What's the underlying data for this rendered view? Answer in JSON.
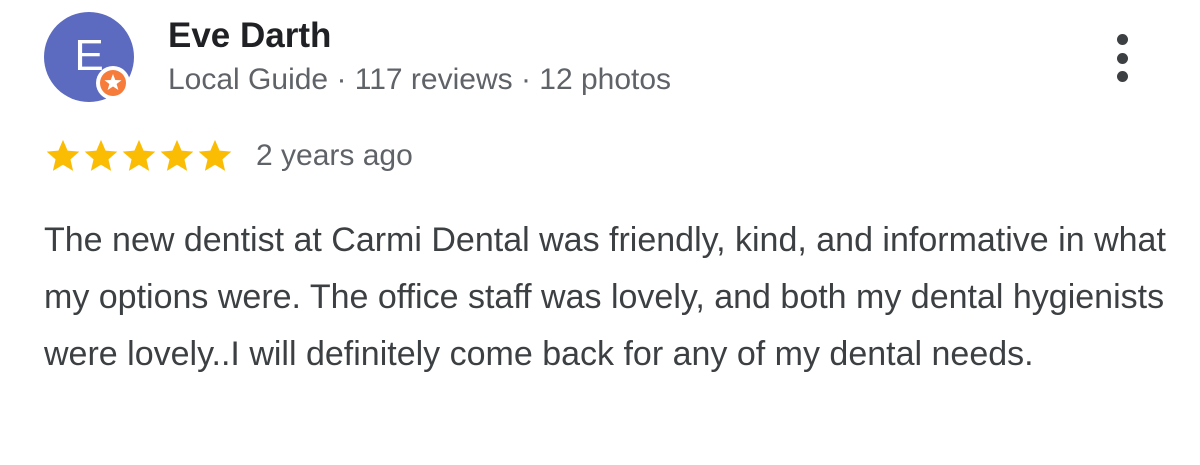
{
  "reviewer": {
    "initial": "E",
    "name": "Eve Darth",
    "meta": "Local Guide · 117 reviews · 12 photos",
    "avatar_color": "#5c6bc0",
    "badge_color": "#f57c3b"
  },
  "review": {
    "stars": 5,
    "star_color": "#fbbc04",
    "date": "2 years ago",
    "text": "The new dentist at Carmi Dental was friendly, kind, and informative in what my options were. The office staff was lovely, and both my dental hygienists were lovely..I will definitely come back for any of my dental needs."
  },
  "icons": {
    "badge": "local-guide-star-icon",
    "more": "more-vert-icon",
    "star": "star-icon"
  }
}
